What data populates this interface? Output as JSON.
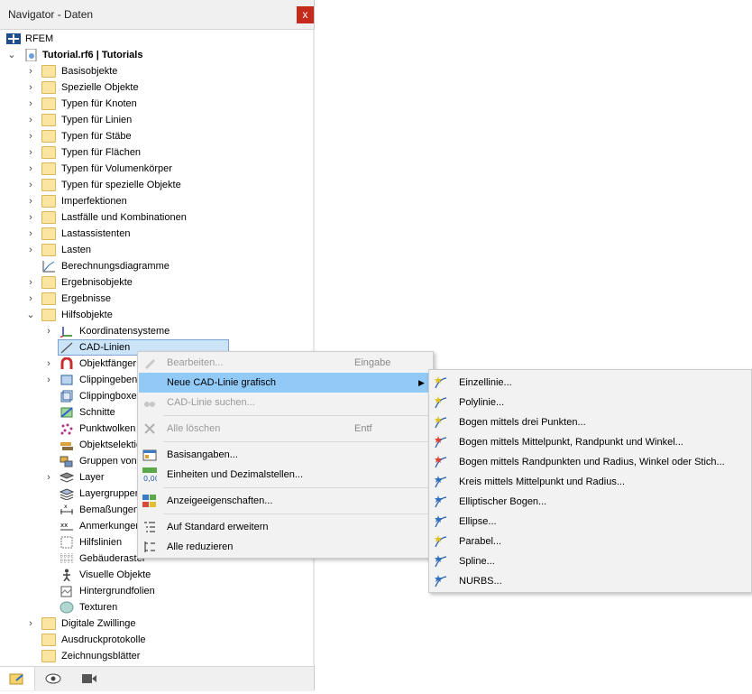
{
  "window": {
    "title": "Navigator - Daten",
    "close_glyph": "x"
  },
  "tree": {
    "root": "RFEM",
    "project": "Tutorial.rf6 | Tutorials",
    "items": [
      "Basisobjekte",
      "Spezielle Objekte",
      "Typen für Knoten",
      "Typen für Linien",
      "Typen für Stäbe",
      "Typen für Flächen",
      "Typen für Volumenkörper",
      "Typen für spezielle Objekte",
      "Imperfektionen",
      "Lastfälle und Kombinationen",
      "Lastassistenten",
      "Lasten",
      "Berechnungsdiagramme",
      "Ergebnisobjekte",
      "Ergebnisse",
      "Hilfsobjekte"
    ],
    "hilfsobjekte_children": [
      "Koordinatensysteme",
      "CAD-Linien",
      "Objektfänger",
      "Clippingebenen",
      "Clippingboxen",
      "Schnitte",
      "Punktwolken",
      "Objektselektionen",
      "Gruppen von",
      "Layer",
      "Layergruppen",
      "Bemaßungen",
      "Anmerkungen",
      "Hilfslinien",
      "Gebäuderaster",
      "Visuelle Objekte",
      "Hintergrundfolien",
      "Texturen"
    ],
    "bottom_items": [
      "Digitale Zwillinge",
      "Ausdruckprotokolle",
      "Zeichnungsblätter"
    ]
  },
  "context_menu": {
    "edit": {
      "label": "Bearbeiten...",
      "shortcut": "Eingabe"
    },
    "new_graphic": {
      "label": "Neue CAD-Linie grafisch"
    },
    "find": {
      "label": "CAD-Linie suchen..."
    },
    "delete_all": {
      "label": "Alle löschen",
      "shortcut": "Entf"
    },
    "base_data": {
      "label": "Basisangaben..."
    },
    "units": {
      "label": "Einheiten und Dezimalstellen..."
    },
    "display": {
      "label": "Anzeigeeigenschaften..."
    },
    "expand": {
      "label": "Auf Standard erweitern"
    },
    "collapse": {
      "label": "Alle reduzieren"
    }
  },
  "submenu": [
    "Einzellinie...",
    "Polylinie...",
    "Bogen mittels drei Punkten...",
    "Bogen mittels Mittelpunkt, Randpunkt und Winkel...",
    "Bogen mittels Randpunkten und Radius, Winkel oder Stich...",
    "Kreis mittels Mittelpunkt und Radius...",
    "Elliptischer Bogen...",
    "Ellipse...",
    "Parabel...",
    "Spline...",
    "NURBS..."
  ],
  "colors": {
    "selection": "#cce4f7",
    "menu_highlight": "#91c9f7",
    "close": "#c42b1c",
    "folder": "#fbe5a1"
  }
}
